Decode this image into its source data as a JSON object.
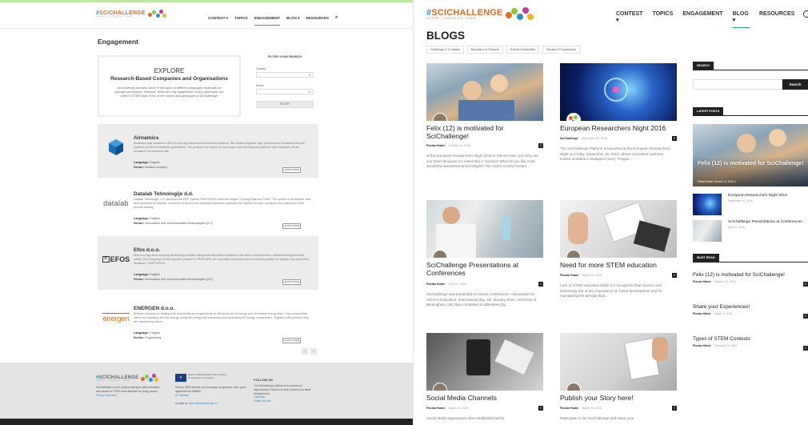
{
  "brand": {
    "hash": "#",
    "name": "SCICHALLENGE",
    "tagline": "INSPIRE · CONTRIBUTE · SHARE",
    "orange": "#e86a1c",
    "blue": "#2e8fc6"
  },
  "left": {
    "nav": [
      "CONTEST ▾",
      "TOPICS",
      "ENGAGEMENT",
      "BLOG ▾",
      "RESOURCES"
    ],
    "page_title": "Engagement",
    "explore": {
      "heading": "EXPLORE",
      "subheading": "Research-Based Companies and Organisations",
      "text": "SciChallenge provides some of the topics in different languages especially for younger participants. However, these are only suggestions. Every participant can select a STEM-topic of his or her choice and participate in SciChallenge!"
    },
    "filter": {
      "heading": "FILTER YOUR SEARCH",
      "country_label": "Country",
      "sector_label": "Sector",
      "button": "FILTER"
    },
    "companies": [
      {
        "name": "Airnamics",
        "desc": "Airnamics was founded in 2012 to develop advanced mechatronic systems. We custom engineer high-performance Unmanned Aircraft Systems (UAS) for industrial applications. The products are based on our unique UAS development platform that integrates virtual simulation environment with",
        "language_label": "Language:",
        "language": "English",
        "sector_label": "Sector:",
        "sector": "Aviation industry",
        "learn": "LEARN MORE"
      },
      {
        "name": "Datalab Tehnologije d.d.",
        "logo_text": "datalab",
        "desc": "Datalab Tehnologije, d.d. develops the ERP System PANTHEON under the slogan \"Turning Data into Profit\". The system is developed, sold and supported by Datalab. A network of service and developer partners implement the system for user, configure and customize it and provide training.",
        "language_label": "Language:",
        "language": "English",
        "sector_label": "Sector:",
        "sector": "Information and communication technologies (ICT)",
        "learn": "LEARN MORE"
      },
      {
        "name": "Efos d.o.o.",
        "logo_text": "EFOS",
        "desc": "Efos is a high-tech company developing complex integrated information systems in the fields of environment, animal tracking and food safety. The Company's most important product is TRAPVIEW, an innovative automated pest monitoring system for optimal crop protection decisions. TRAPVIEW is",
        "language_label": "Language:",
        "language": "English",
        "sector_label": "Sector:",
        "sector": "Information and communication technologies (ICT)",
        "learn": "LEARN MORE"
      },
      {
        "name": "ENERGEN d.o.o.",
        "logo_text": "energen",
        "desc": "Energen company is dealing with researches and engineering on efficiency use of energy and renewable energy area. They consult their clients by supplying with the energy, using the energy and monitoring and controlling the energy consumption. Together with partners they are researching how to",
        "language_label": "Language:",
        "language": "English",
        "sector_label": "Sector:",
        "sector": "Engineering",
        "learn": "LEARN MORE"
      }
    ],
    "pager": [
      "‹",
      "›"
    ],
    "footer": {
      "about": "SciChallenge is an EU project aiming to make education and careers in STEM more attractive for young people.",
      "about_link": "Privacy Statement",
      "eu_text": "Horizon 2020 European Union Funding for Research & Innovation",
      "grant": "Horizon 2020 research and innovation programme under grant agreement No 665805.",
      "grant_link": "EU Website",
      "contact": "Contact us:",
      "contact_email": "support@scichallenge.eu",
      "follow_heading": "FOLLOW US",
      "follow_text": "The SciChallenge platform is in continuous improvement. Follow us to find out about our latest developments.",
      "links": [
        "Facebook",
        "Twitter account"
      ]
    }
  },
  "right": {
    "nav": [
      "CONTEST ▾",
      "TOPICS",
      "ENGAGEMENT",
      "BLOG ▾",
      "RESOURCES"
    ],
    "page_title": "BLOGS",
    "tags": [
      "Challenge & Contests",
      "Education & Careers",
      "Events & Activities",
      "Stories & Experiences"
    ],
    "posts": [
      {
        "title": "Felix (12) is motivated for SciChallenge!",
        "author": "Florian Huber",
        "date": "October 12, 2016",
        "count": "0",
        "excerpt": "at the European Researchers Night 2016 in Vienna Felix (12) Why are you here? Because I'm interested in Science! What do you like most about#EuropeanResearchersNight? The CERN Control Centre..."
      },
      {
        "title": "European Researchers Night 2016",
        "author": "SciChallenge",
        "date": "September 29, 2016",
        "count": "0",
        "excerpt": "The SciChallenge Platform is launched at the European Researchers Night on Friday, September 30, 2016, where consortium partners hosted activities in Budapest (Hun), Prague..."
      },
      {
        "title": "SciChallenge Presentations at Conferences",
        "author": "Florian Huber",
        "date": "April 21, 2016",
        "count": "0",
        "excerpt": "SciChallenge was presented at various conferences: Association for Science Education, International day, 6th January 2016, University of Birmingham (UK) flyer circulation to attendees (by..."
      },
      {
        "title": "Need for more STEM education",
        "author": "Florian Huber",
        "date": "March 31, 2016",
        "count": "0",
        "excerpt": "Lack of STEM education While it is recognized that science and technology are of key importance for future development and for maintaining the already high..."
      },
      {
        "title": "Social Media Channels",
        "author": "Florian Huber",
        "date": "March 29, 2016",
        "count": "0",
        "excerpt": "Social Media appearance was established and is"
      },
      {
        "title": "Publish your Story here!",
        "author": "Florian Huber",
        "date": "March 29, 2016",
        "count": "0",
        "excerpt": "Participate in the SciChallenge and share your"
      }
    ],
    "sidebar": {
      "search_heading": "SEARCH",
      "search_button": "Search",
      "latest_heading": "LATEST POSTS",
      "latest_main": {
        "title": "Felix (12) is motivated for SciChallenge!",
        "meta": "Florian Huber  October 12, 2016",
        "count": "0"
      },
      "latest_list": [
        {
          "title": "European Researchers Night 2016",
          "date": "September 29, 2016"
        },
        {
          "title": "SciChallenge Presentations at Conferences",
          "date": "April 21, 2016"
        }
      ],
      "must_read_heading": "MUST READ",
      "must_read": [
        {
          "title": "Felix (12) is motivated for SciChallenge!",
          "author": "Florian Huber",
          "date": "October 12, 2016",
          "count": "0"
        },
        {
          "title": "Share your Experiences!",
          "author": "Florian Huber",
          "date": "March 6, 2016",
          "count": "0"
        },
        {
          "title": "Types of STEM Contests",
          "author": "Florian Huber",
          "date": "February 23, 2016",
          "count": "0"
        }
      ]
    }
  }
}
